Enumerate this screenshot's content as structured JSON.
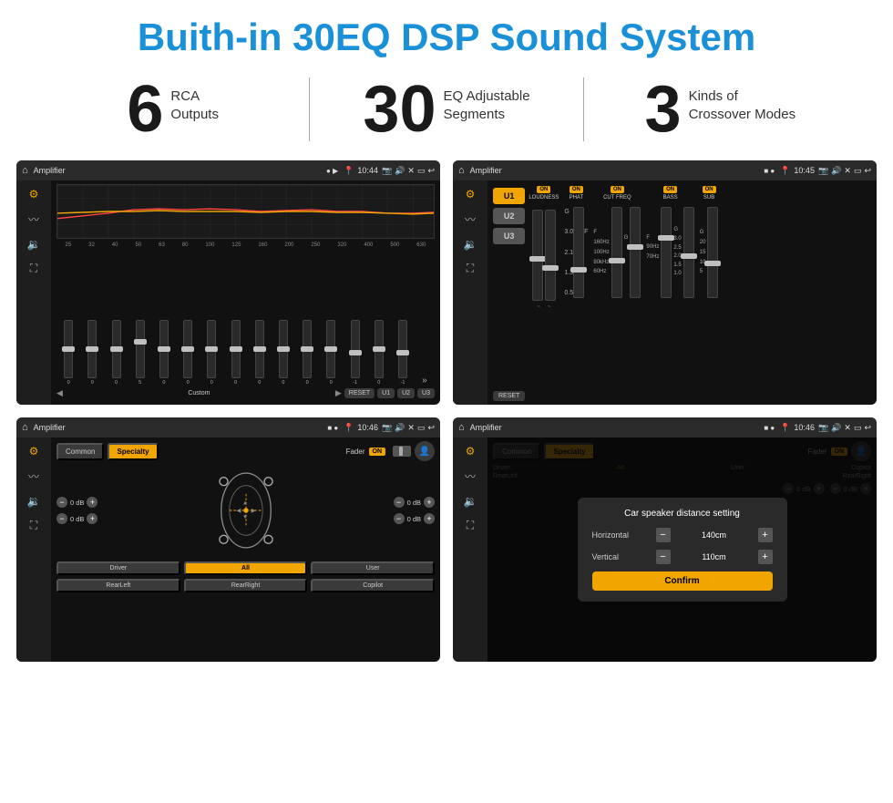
{
  "header": {
    "title": "Buith-in 30EQ DSP Sound System"
  },
  "stats": [
    {
      "number": "6",
      "line1": "RCA",
      "line2": "Outputs"
    },
    {
      "number": "30",
      "line1": "EQ Adjustable",
      "line2": "Segments"
    },
    {
      "number": "3",
      "line1": "Kinds of",
      "line2": "Crossover Modes"
    }
  ],
  "screens": [
    {
      "id": "screen1",
      "statusbar": {
        "title": "Amplifier",
        "time": "10:44"
      },
      "type": "eq",
      "freqs": [
        "25",
        "32",
        "40",
        "50",
        "63",
        "80",
        "100",
        "125",
        "160",
        "200",
        "250",
        "320",
        "400",
        "500",
        "630"
      ],
      "values": [
        "0",
        "0",
        "0",
        "5",
        "0",
        "0",
        "0",
        "0",
        "0",
        "0",
        "0",
        "0",
        "-1",
        "0",
        "-1"
      ],
      "presets": [
        "Custom",
        "RESET",
        "U1",
        "U2",
        "U3"
      ]
    },
    {
      "id": "screen2",
      "statusbar": {
        "title": "Amplifier",
        "time": "10:45"
      },
      "type": "amp",
      "userButtons": [
        "U1",
        "U2",
        "U3"
      ],
      "controls": [
        "LOUDNESS",
        "PHAT",
        "CUT FREQ",
        "BASS",
        "SUB"
      ],
      "resetLabel": "RESET"
    },
    {
      "id": "screen3",
      "statusbar": {
        "title": "Amplifier",
        "time": "10:46"
      },
      "type": "fade",
      "tabs": [
        "Common",
        "Specialty"
      ],
      "activeTab": "Specialty",
      "faderLabel": "Fader",
      "faderOn": "ON",
      "channels": [
        {
          "label": "0 dB"
        },
        {
          "label": "0 dB"
        },
        {
          "label": "0 dB"
        },
        {
          "label": "0 dB"
        }
      ],
      "bottomBtns": [
        "Driver",
        "RearLeft",
        "All",
        "User",
        "RearRight",
        "Copilot"
      ]
    },
    {
      "id": "screen4",
      "statusbar": {
        "title": "Amplifier",
        "time": "10:46"
      },
      "type": "dialog",
      "tabs": [
        "Common",
        "Specialty"
      ],
      "dialogTitle": "Car speaker distance setting",
      "fields": [
        {
          "label": "Horizontal",
          "value": "140cm"
        },
        {
          "label": "Vertical",
          "value": "110cm"
        }
      ],
      "confirmLabel": "Confirm",
      "rightPanel": {
        "label1": "0 dB",
        "label2": "0 dB"
      },
      "bottomBtns": [
        "Driver",
        "RearLeft",
        "All",
        "User",
        "RearRight",
        "Copilot"
      ]
    }
  ]
}
